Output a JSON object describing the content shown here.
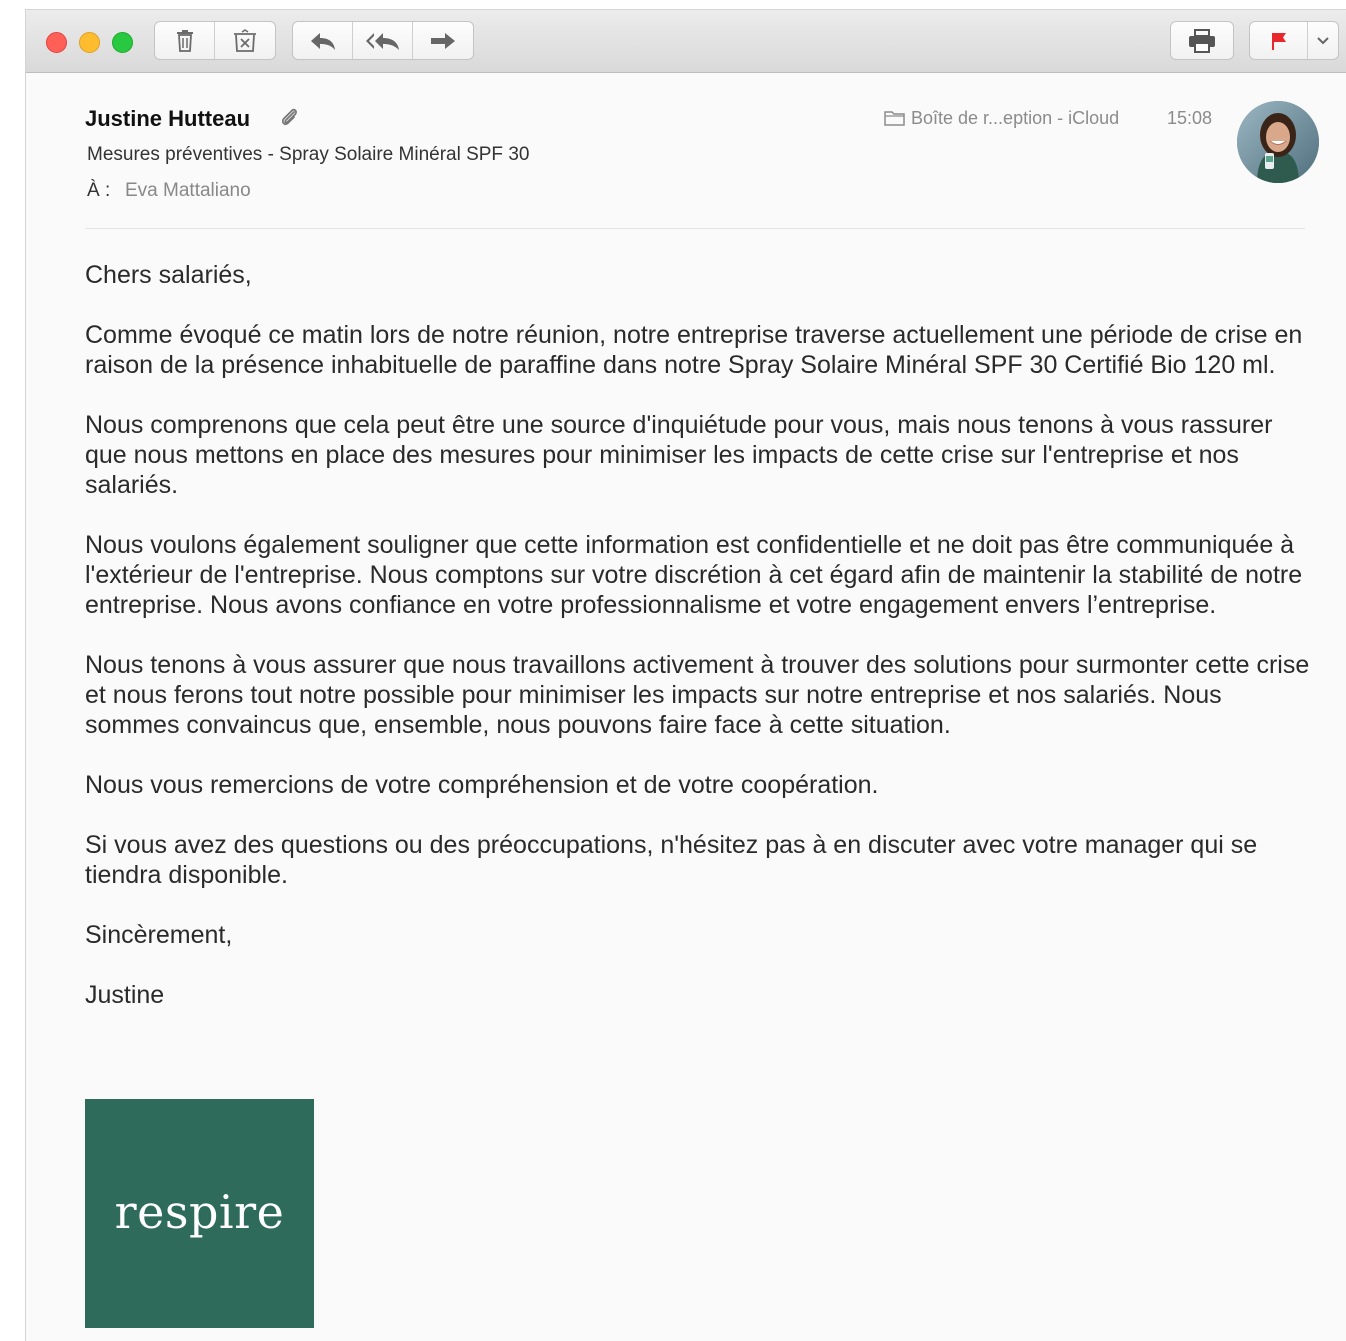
{
  "toolbar": {
    "icons": [
      "trash-icon",
      "junk-icon",
      "reply-icon",
      "reply-all-icon",
      "forward-icon",
      "print-icon",
      "flag-icon",
      "chevron-down-icon"
    ],
    "flag_color": "#e8262b"
  },
  "header": {
    "sender": "Justine Hutteau",
    "subject": "Mesures préventives - Spray Solaire Minéral SPF 30",
    "to_label": "À :",
    "to_value": "Eva Mattaliano",
    "mailbox": "Boîte de r...eption - iCloud",
    "time": "15:08"
  },
  "body": {
    "greeting": "Chers salariés,",
    "paragraphs": [
      "Comme évoqué ce matin lors de notre réunion, notre entreprise traverse actuellement une période de crise en raison de la présence inhabituelle de paraffine dans notre Spray Solaire Minéral SPF 30 Certifié Bio 120 ml.",
      "Nous comprenons que cela peut être une source d'inquiétude pour vous, mais nous tenons à vous rassurer que nous mettons en place des mesures pour minimiser les impacts de cette crise sur l'entreprise et nos salariés.",
      "Nous voulons également souligner que cette information est confidentielle et ne doit pas être communiquée à l'extérieur de l'entreprise. Nous comptons sur votre discrétion à cet égard afin de maintenir la stabilité de notre entreprise. Nous avons confiance en votre professionnalisme et votre engagement envers l’entreprise.",
      "Nous tenons à vous assurer que nous travaillons activement à trouver des solutions pour surmonter cette crise et nous ferons tout notre possible pour minimiser les impacts sur notre entreprise et nos salariés. Nous sommes convaincus que, ensemble, nous pouvons faire face à cette situation.",
      "Nous vous remercions de votre compréhension et de votre coopération.",
      "Si vous avez des questions ou des préoccupations, n'hésitez pas à en discuter avec votre manager qui se tiendra disponible."
    ],
    "closing": "Sincèrement,",
    "signature": "Justine"
  },
  "logo": {
    "text": "respire",
    "color": "#2e6b5b"
  }
}
